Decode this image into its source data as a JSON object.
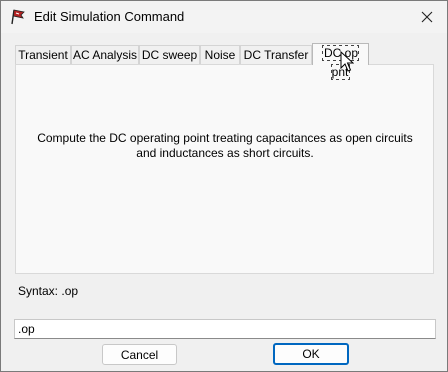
{
  "window": {
    "title": "Edit Simulation Command",
    "icons": {
      "app": "simulation-flag-icon",
      "close": "close-icon"
    }
  },
  "tabs": [
    {
      "label": "Transient",
      "active": false
    },
    {
      "label": "AC Analysis",
      "active": false
    },
    {
      "label": "DC sweep",
      "active": false
    },
    {
      "label": "Noise",
      "active": false
    },
    {
      "label": "DC Transfer",
      "active": false
    },
    {
      "label": "DC op pnt",
      "active": true
    }
  ],
  "panel": {
    "description": "Compute the DC operating point treating capacitances as open circuits and inductances as short circuits."
  },
  "syntax": {
    "text": "Syntax: .op"
  },
  "command": {
    "value": ".op"
  },
  "buttons": {
    "cancel": "Cancel",
    "ok": "OK"
  },
  "colors": {
    "accent": "#0067c0",
    "app_icon": "#b22222"
  }
}
